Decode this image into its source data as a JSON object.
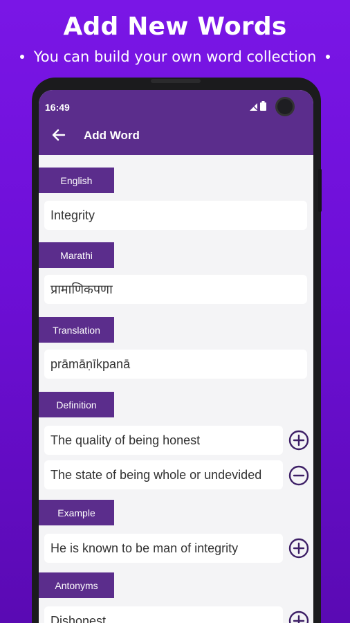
{
  "promo": {
    "title": "Add New Words",
    "subtitle": "You can build your own word collection"
  },
  "status_bar": {
    "time": "16:49"
  },
  "app_bar": {
    "title": "Add Word"
  },
  "form": {
    "english": {
      "label": "English",
      "value": "Integrity"
    },
    "marathi": {
      "label": "Marathi",
      "value": "प्रामाणिकपणा"
    },
    "translation": {
      "label": "Translation",
      "value": "prāmāṇīkpanā"
    },
    "definition": {
      "label": "Definition",
      "items": [
        "The quality of being honest",
        "The state of being whole or undevided"
      ]
    },
    "example": {
      "label": "Example",
      "items": [
        "He is known to be man of integrity"
      ]
    },
    "antonyms": {
      "label": "Antonyms",
      "items": [
        "Dishonest"
      ]
    }
  },
  "colors": {
    "primary": "#5b2d8c",
    "background": "#7a16e6",
    "field": "#ffffff"
  },
  "icons": {
    "add": "plus-circle-icon",
    "remove": "minus-circle-icon",
    "back": "arrow-left-icon"
  }
}
